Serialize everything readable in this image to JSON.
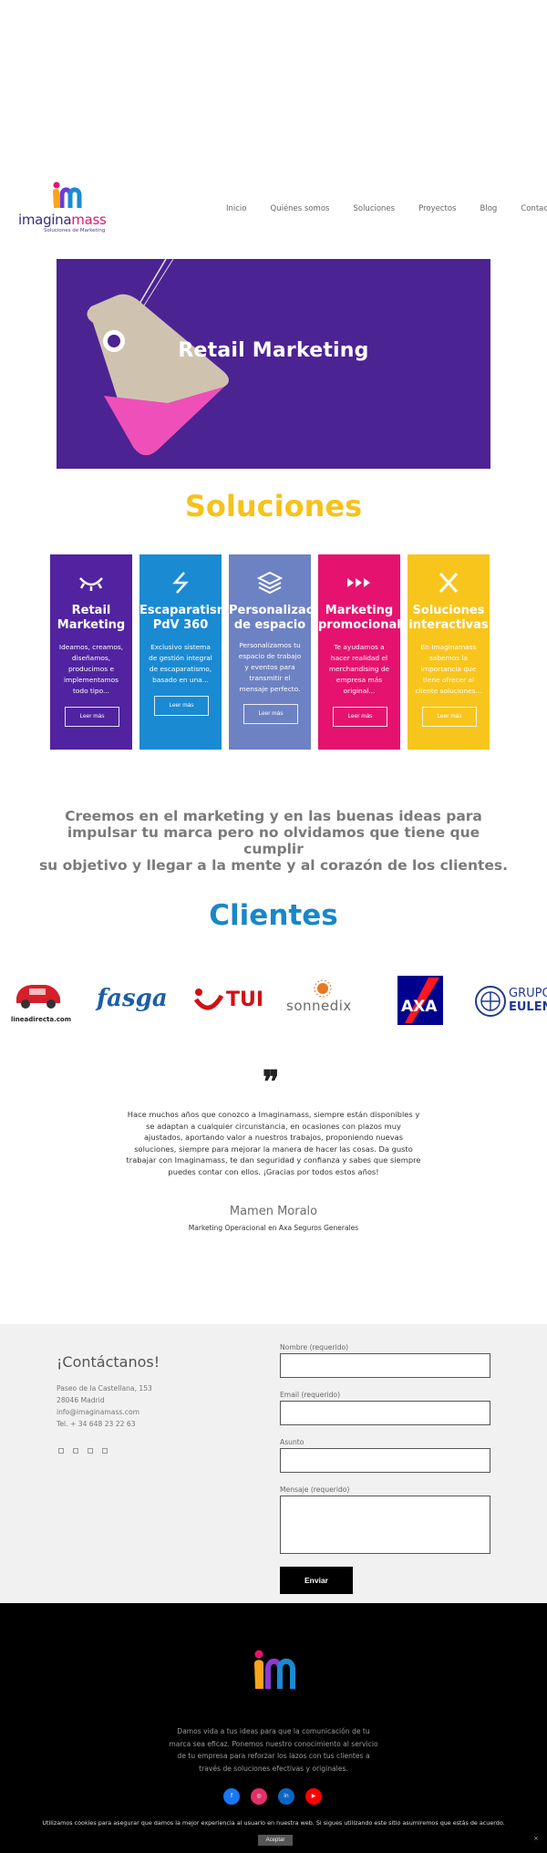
{
  "header": {
    "logo": {
      "word_main": "imagina",
      "word_accent": "mass",
      "tagline": "Soluciones de Marketing"
    },
    "nav": [
      "Inicio",
      "Quiénes somos",
      "Soluciones",
      "Proyectos",
      "Blog",
      "Contacto"
    ]
  },
  "hero": {
    "title": "Retail Marketing"
  },
  "soluciones": {
    "title": "Soluciones",
    "cards": [
      {
        "title_1": "Retail",
        "title_2": "Marketing",
        "text": "Ideamos, creamos, diseñamos, producimos e implementamos todo tipo...",
        "button": "Leer más",
        "color": "#5123a0",
        "icon": "eye-icon"
      },
      {
        "title_1": "Escaparatism",
        "title_2": "PdV 360",
        "text": "Exclusivo sistema de gestión integral de escaparatismo, basado en una...",
        "button": "Leer más",
        "color": "#1a8ad3",
        "icon": "bolt-icon"
      },
      {
        "title_1": "Personalizac",
        "title_2": "de espacio",
        "text": "Personalizamos tu espacio de trabajo y eventos para transmitir el mensaje perfecto.",
        "button": "Leer más",
        "color": "#6d82c3",
        "icon": "layers-icon"
      },
      {
        "title_1": "Marketing",
        "title_2": "promocional",
        "text": "Te ayudamos a hacer realidad el merchandising de empresa más original...",
        "button": "Leer más",
        "color": "#e6126f",
        "icon": "forward-icon"
      },
      {
        "title_1": "Soluciones",
        "title_2": "interactivas",
        "text": "En Imaginamass sabemos la importancia que tiene ofrecer al cliente soluciones...",
        "button": "Leer más",
        "color": "#f8c51c",
        "icon": "close-icon"
      }
    ]
  },
  "statement": {
    "lines": [
      "Creemos en el marketing y en las buenas ideas para",
      "impulsar tu marca pero no olvidamos que tiene que cumplir",
      "su objetivo y llegar a la mente y al corazón de los clientes."
    ]
  },
  "clientes": {
    "title": "Clientes",
    "logos": [
      "lineadirecta.com",
      "fasga",
      "TUI",
      "sonnedix",
      "AXA",
      "GRUPO",
      "EULEN"
    ]
  },
  "testimonial": {
    "text": "Hace muchos años que conozco a Imaginamass, siempre están disponibles y se adaptan a cualquier circunstancia, en ocasiones con plazos muy ajustados, aportando valor a nuestros trabajos, proponiendo nuevas soluciones, siempre para mejorar la manera de hacer las cosas. Da gusto trabajar con Imaginamass, te dan seguridad y confianza y sabes que siempre puedes contar con ellos. ¡Gracias por todos estos años!",
    "name": "Mamen Moralo",
    "role": "Marketing Operacional en Axa Seguros Generales"
  },
  "contact": {
    "title": "¡Contáctanos!",
    "address_1": "Paseo de la Castellana, 153",
    "address_2": "28046 Madrid",
    "email": "info@imaginamass.com",
    "phone": "Tel. + 34 648 23 22 63",
    "form": {
      "name_label": "Nombre (requerido)",
      "email_label": "Email (requerido)",
      "subject_label": "Asunto",
      "message_label": "Mensaje (requerido)",
      "submit": "Enviar"
    }
  },
  "footer": {
    "text": "Damos vida a tus ideas para que la comunicación de tu marca sea eficaz. Ponemos nuestro conocimiento al servicio de tu empresa para reforzar los lazos con tus clientes a través de soluciones efectivas y originales.",
    "social": [
      {
        "icon": "facebook-icon",
        "color": "#1877f2"
      },
      {
        "icon": "instagram-icon",
        "color": "#e1306c"
      },
      {
        "icon": "linkedin-icon",
        "color": "#0a66c2"
      },
      {
        "icon": "youtube-icon",
        "color": "#ff0000"
      }
    ]
  },
  "cookie": {
    "text": "Utilizamos cookies para asegurar que damos la mejor experiencia al usuario en nuestra web. Si sigues utilizando este sitio asumiremos que estás de acuerdo.",
    "accept": "Aceptar",
    "close": "×"
  }
}
